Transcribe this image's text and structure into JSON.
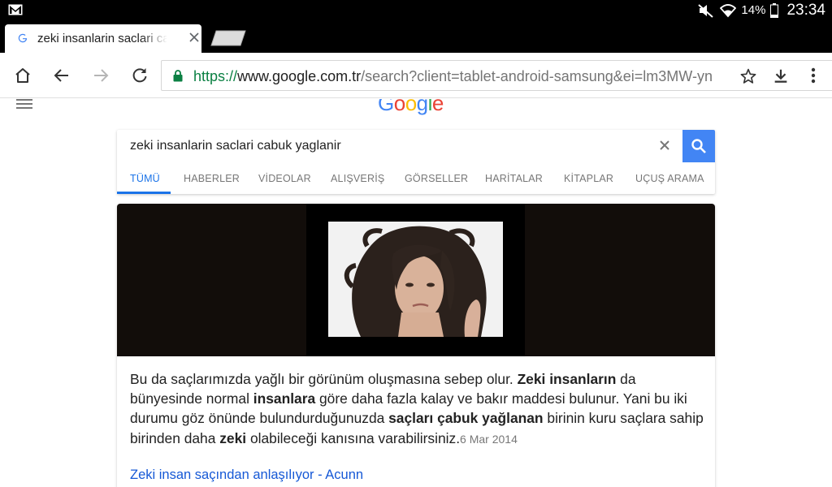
{
  "status_bar": {
    "battery": "14%",
    "time": "23:34"
  },
  "tab": {
    "title": "zeki insanlarin saclari cabuk yaglanir"
  },
  "omnibox": {
    "scheme": "https://",
    "host": "www.google.com.tr",
    "path": "/search?client=tablet-android-samsung&ei=lm3MW-yn"
  },
  "google": {
    "logo": [
      "G",
      "o",
      "o",
      "g",
      "l",
      "e"
    ],
    "query": "zeki insanlarin saclari cabuk yaglanir",
    "tabs": [
      {
        "label": "TÜMÜ",
        "active": true
      },
      {
        "label": "HABERLER"
      },
      {
        "label": "VİDEOLAR"
      },
      {
        "label": "ALIŞVERİŞ"
      },
      {
        "label": "GÖRSELLER"
      },
      {
        "label": "HARİTALAR"
      },
      {
        "label": "KİTAPLAR"
      },
      {
        "label": "UÇUŞ ARAMA"
      }
    ]
  },
  "result": {
    "snippet_parts": [
      {
        "t": "Bu da saçlarımızda yağlı bir görünüm oluşmasına sebep olur. "
      },
      {
        "t": "Zeki insanların",
        "b": true
      },
      {
        "t": " da bünyesinde normal "
      },
      {
        "t": "insanlara",
        "b": true
      },
      {
        "t": " göre daha fazla kalay ve bakır maddesi bulunur. Yani bu iki durumu göz önünde bulundurduğunuzda "
      },
      {
        "t": "saçları çabuk yağlanan",
        "b": true
      },
      {
        "t": " birinin kuru saçlara sahip birinden daha "
      },
      {
        "t": "zeki",
        "b": true
      },
      {
        "t": " olabileceği kanısına varabilirsiniz."
      }
    ],
    "date": "6 Mar 2014",
    "link_title": "Zeki insan saçından anlaşılıyor - Acunn"
  },
  "colors": {
    "accent": "#4285f4",
    "active_tab": "#1a73e8",
    "secure_scheme": "#0b8043",
    "link": "#1558d6"
  }
}
